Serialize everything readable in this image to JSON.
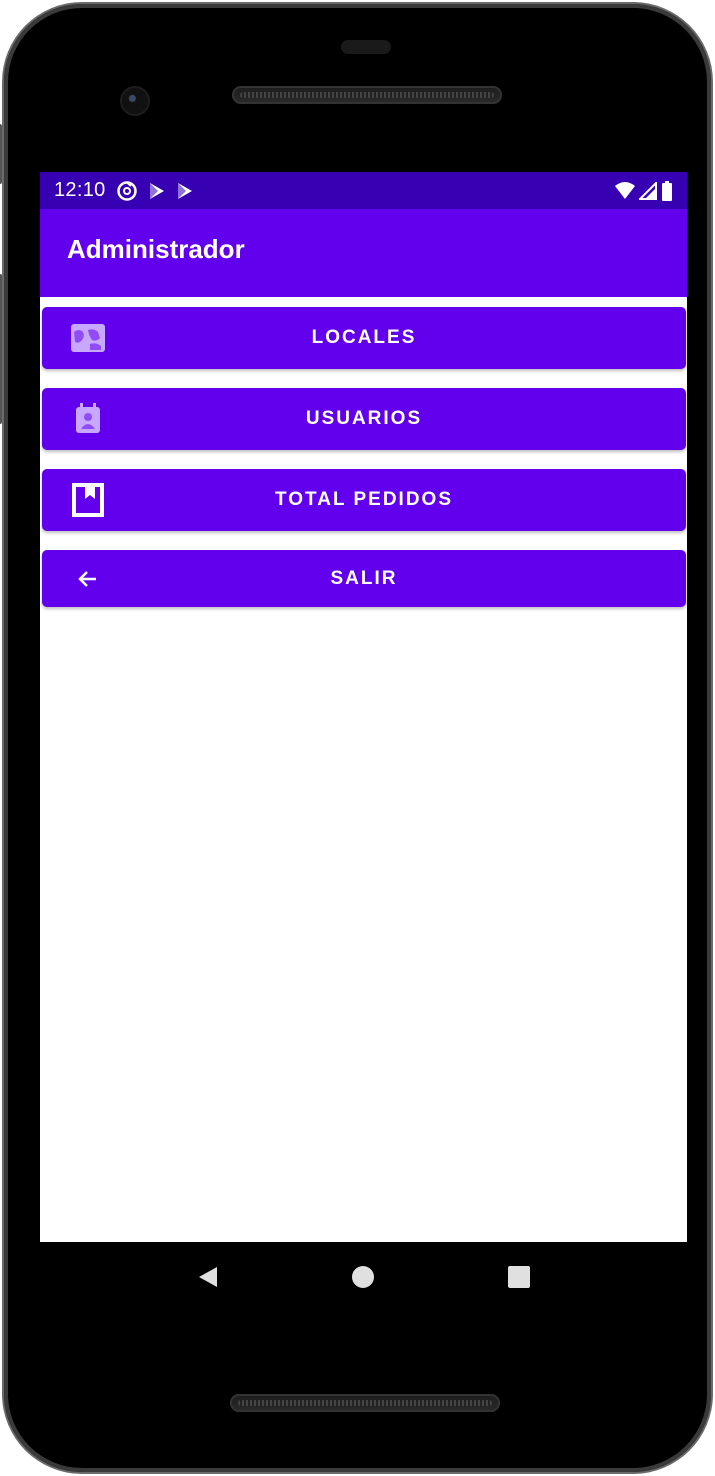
{
  "status_bar": {
    "time": "12:10",
    "left_icons": [
      "sync-icon",
      "play-store-icon",
      "play-store-icon"
    ],
    "right_icons": [
      "wifi-icon",
      "signal-icon",
      "battery-icon"
    ]
  },
  "app_bar": {
    "title": "Administrador"
  },
  "menu": {
    "items": [
      {
        "label": "LOCALES",
        "icon": "map-icon"
      },
      {
        "label": "USUARIOS",
        "icon": "calendar-person-icon"
      },
      {
        "label": "TOTAL PEDIDOS",
        "icon": "bookmark-box-icon"
      },
      {
        "label": "SALIR",
        "icon": "arrow-back-icon"
      }
    ]
  },
  "nav_bar": {
    "buttons": [
      "back-triangle-icon",
      "home-circle-icon",
      "recents-square-icon"
    ]
  },
  "colors": {
    "primary": "#6200EE",
    "primary_dark": "#3700B3",
    "on_primary": "#FFFFFF",
    "icon_tint": "#C8A8FF"
  }
}
